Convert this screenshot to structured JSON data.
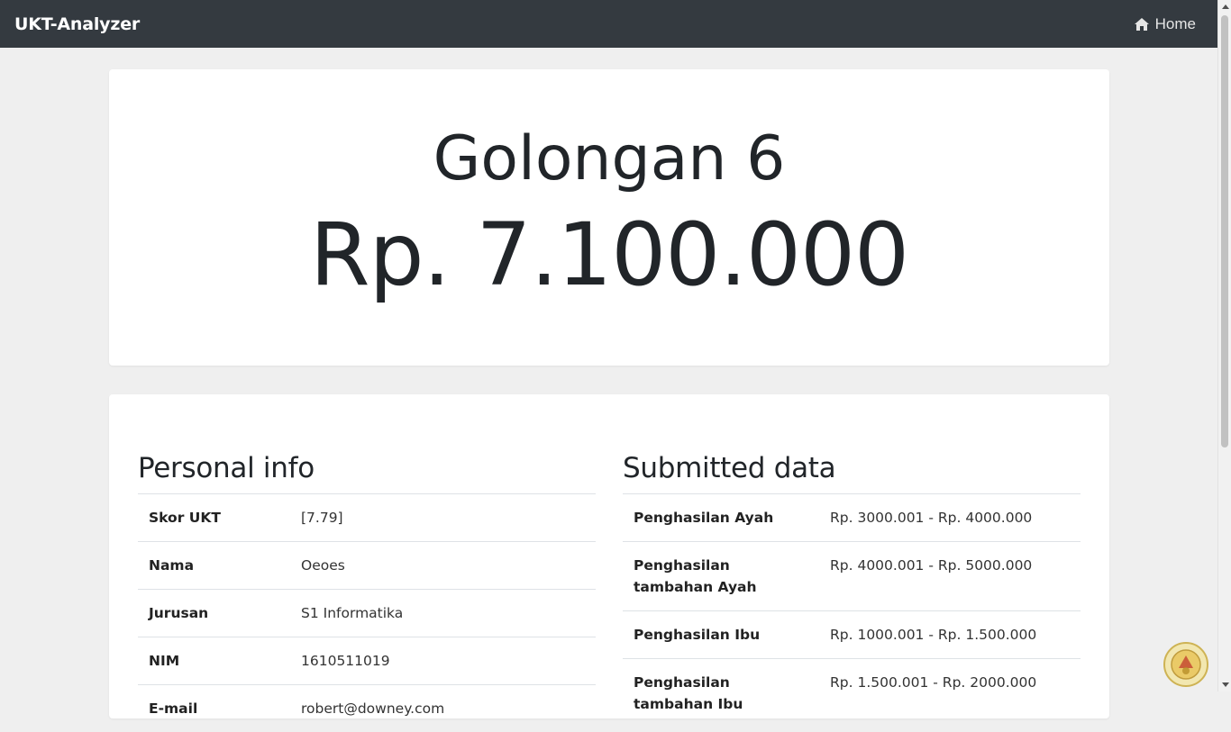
{
  "navbar": {
    "brand": "UKT-Analyzer",
    "home_label": "Home",
    "home_icon": "home-icon"
  },
  "result": {
    "golongan": "Golongan 6",
    "amount": "Rp. 7.100.000"
  },
  "personal_info": {
    "title": "Personal info",
    "rows": [
      {
        "label": "Skor UKT",
        "value": "[7.79]"
      },
      {
        "label": "Nama",
        "value": "Oeoes"
      },
      {
        "label": "Jurusan",
        "value": "S1 Informatika"
      },
      {
        "label": "NIM",
        "value": "1610511019"
      },
      {
        "label": "E-mail",
        "value": "robert@downey.com"
      }
    ]
  },
  "submitted_data": {
    "title": "Submitted data",
    "rows": [
      {
        "label": "Penghasilan Ayah",
        "value": "Rp. 3000.001 - Rp. 4000.000"
      },
      {
        "label": "Penghasilan tambahan Ayah",
        "value": "Rp. 4000.001 - Rp. 5000.000"
      },
      {
        "label": "Penghasilan Ibu",
        "value": "Rp. 1000.001 - Rp. 1.500.000"
      },
      {
        "label": "Penghasilan tambahan Ibu",
        "value": "Rp. 1.500.001 - Rp. 2000.000"
      }
    ]
  },
  "colors": {
    "navbar_bg": "#343a40",
    "page_bg": "#efefef",
    "card_bg": "#ffffff"
  }
}
